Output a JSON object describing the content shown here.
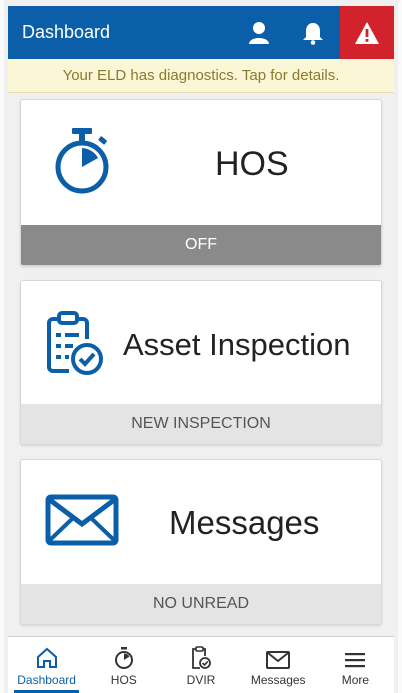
{
  "app_bar": {
    "title": "Dashboard",
    "profile_icon": "person-icon",
    "notifications_icon": "bell-icon",
    "alert_icon": "warning-icon"
  },
  "banner": {
    "text": "Your ELD has diagnostics. Tap for details."
  },
  "cards": {
    "hos": {
      "title": "HOS",
      "status": "OFF",
      "icon": "stopwatch-icon"
    },
    "inspection": {
      "title": "Asset Inspection",
      "status": "NEW INSPECTION",
      "icon": "clipboard-check-icon"
    },
    "messages": {
      "title": "Messages",
      "status": "NO UNREAD",
      "icon": "envelope-icon"
    }
  },
  "bottom_nav": {
    "dashboard": "Dashboard",
    "hos": "HOS",
    "dvir": "DVIR",
    "messages": "Messages",
    "more": "More"
  },
  "colors": {
    "primary": "#0b5fa8",
    "alert": "#d2222c",
    "banner_bg": "#fbf6d6",
    "hos_status_bg": "#8a8a8a"
  }
}
